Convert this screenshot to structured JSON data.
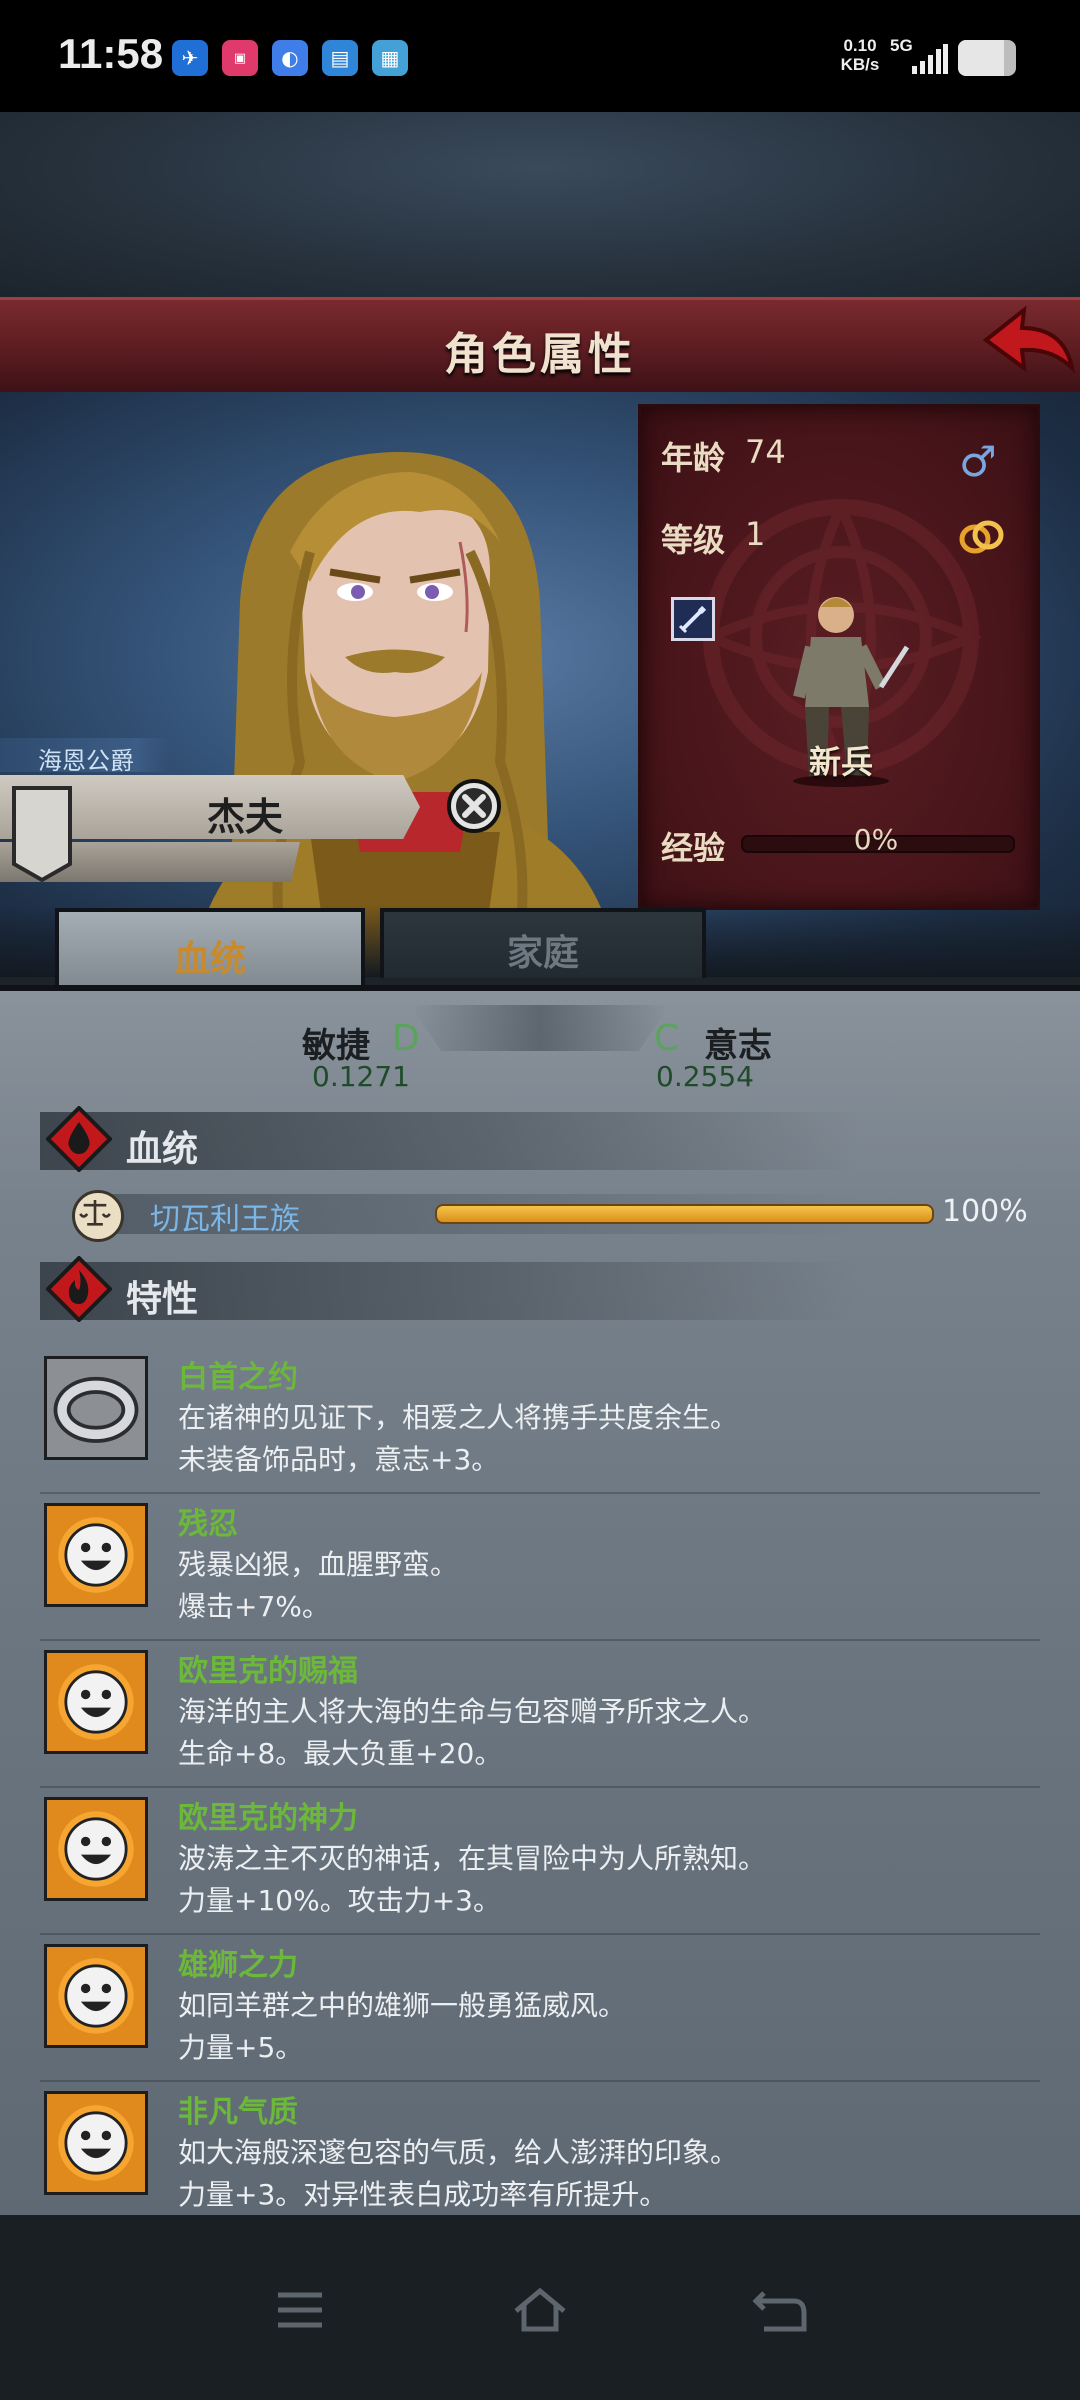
{
  "status_bar": {
    "time": "11:58",
    "net_speed_value": "0.10",
    "net_speed_unit": "KB/s",
    "network": "5G",
    "battery_level": 0.8,
    "app_icons": [
      "app-icon-blue",
      "app-icon-bilibili",
      "app-icon-cloud",
      "app-icon-doc",
      "app-icon-media"
    ]
  },
  "header": {
    "title": "角色属性"
  },
  "character": {
    "title": "海恩公爵",
    "name": "杰夫"
  },
  "stats": {
    "age_label": "年龄",
    "age_value": "74",
    "level_label": "等级",
    "level_value": "1",
    "class_name": "新兵",
    "exp_label": "经验",
    "exp_value": "0%"
  },
  "tabs": {
    "bloodline": "血统",
    "family": "家庭",
    "active": "bloodline"
  },
  "attributes": {
    "left": {
      "label": "敏捷",
      "grade": "D",
      "value": "0.1271"
    },
    "right": {
      "label": "意志",
      "grade": "C",
      "value": "0.2554"
    }
  },
  "sections": {
    "bloodline_title": "血统",
    "traits_title": "特性"
  },
  "bloodline": {
    "name": "切瓦利王族",
    "percent": "100%",
    "fill": 1.0
  },
  "traits": [
    {
      "icon": "ring-icon",
      "name": "白首之约",
      "desc": "在诸神的见证下，相爱之人将携手共度余生。",
      "effect": "未装备饰品时，意志+3。"
    },
    {
      "icon": "smile-sun-icon",
      "name": "残忍",
      "desc": "残暴凶狠，血腥野蛮。",
      "effect": "爆击+7%。"
    },
    {
      "icon": "smile-sun-icon",
      "name": "欧里克的赐福",
      "desc": "海洋的主人将大海的生命与包容赠予所求之人。",
      "effect": "生命+8。最大负重+20。"
    },
    {
      "icon": "smile-sun-icon",
      "name": "欧里克的神力",
      "desc": "波涛之主不灭的神话，在其冒险中为人所熟知。",
      "effect": "力量+10%。攻击力+3。"
    },
    {
      "icon": "smile-sun-icon",
      "name": "雄狮之力",
      "desc": "如同羊群之中的雄狮一般勇猛威风。",
      "effect": "力量+5。"
    },
    {
      "icon": "smile-sun-icon",
      "name": "非凡气质",
      "desc": "如大海般深邃包容的气质，给人澎湃的印象。",
      "effect": "力量+3。对异性表白成功率有所提升。"
    }
  ],
  "colors": {
    "banner": "#6b2227",
    "trait_name": "#6cb83a",
    "bloodline_name": "#7bb6e8",
    "tab_active": "#c98a2b",
    "grade": "#5aa35c"
  }
}
